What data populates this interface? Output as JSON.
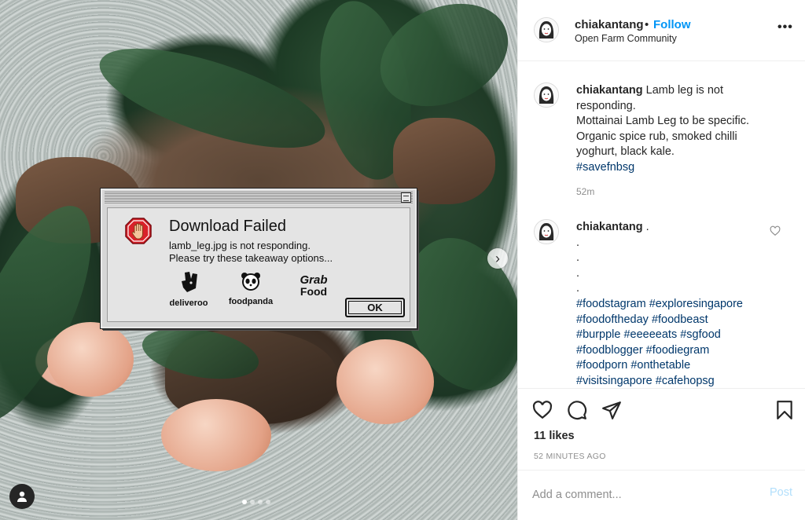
{
  "post": {
    "username": "chiakantang",
    "dot": "•",
    "follow_label": "Follow",
    "location": "Open Farm Community",
    "more_label": "•••"
  },
  "dialog": {
    "title": "Download Failed",
    "message_line1": "lamb_leg.jpg is not responding.",
    "message_line2": "Please try these takeaway options...",
    "brands": {
      "deliveroo": "deliveroo",
      "foodpanda": "foodpanda",
      "grab_line1": "Grab",
      "grab_line2": "Food"
    },
    "ok_label": "OK"
  },
  "caption": {
    "username": "chiakantang",
    "line1": " Lamb leg is not responding.",
    "line2": "Mottainai Lamb Leg to be specific.",
    "line3": "Organic spice rub, smoked chilli yoghurt, black kale.",
    "hashtag": "#savefnbsg",
    "time": "52m"
  },
  "comment2": {
    "username": "chiakantang",
    "suffix": " .",
    "dots": [
      ".",
      ".",
      ".",
      "."
    ],
    "hashtags": [
      "#foodstagram #exploresingapore",
      "#foodoftheday #foodbeast",
      "#burpple #eeeeeats #sgfood",
      "#foodblogger #foodiegram",
      "#foodporn #onthetable",
      "#visitsingapore #cafehopsg"
    ]
  },
  "actions": {
    "likes": "11 likes",
    "post_time": "52 MINUTES AGO"
  },
  "comment_box": {
    "placeholder": "Add a comment...",
    "post_label": "Post"
  },
  "carousel": {
    "next_label": "›",
    "dots": 4,
    "active_dot": 1
  },
  "colors": {
    "link_blue": "#0095f6",
    "hashtag": "#00376b",
    "muted": "#8e8e8e",
    "post_disabled": "#b2dffc",
    "stop_red": "#d9222a"
  },
  "icons": {
    "heart": "heart-icon",
    "comment": "comment-icon",
    "share": "paper-plane-icon",
    "save": "bookmark-icon",
    "more": "ellipsis-icon",
    "stop": "stop-hand-icon",
    "tag_user": "user-icon"
  }
}
